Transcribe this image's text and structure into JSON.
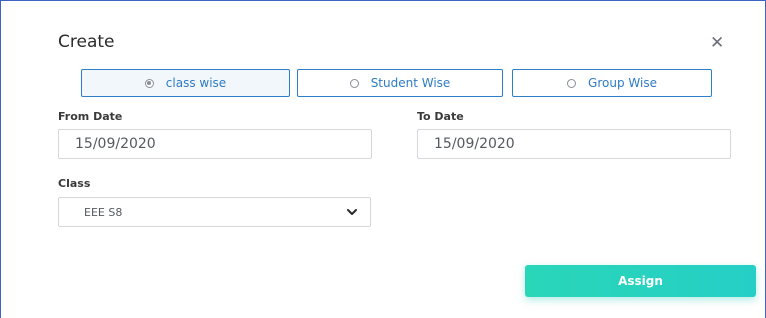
{
  "dialog": {
    "title": "Create",
    "close_icon": "close-icon"
  },
  "mode_options": [
    {
      "label": "class wise",
      "selected": true
    },
    {
      "label": "Student Wise",
      "selected": false
    },
    {
      "label": "Group Wise",
      "selected": false
    }
  ],
  "from_date": {
    "label": "From Date",
    "value": "15/09/2020"
  },
  "to_date": {
    "label": "To Date",
    "value": "15/09/2020"
  },
  "class_field": {
    "label": "Class",
    "selected_value": "EEE S8",
    "icon": "chevron-down-icon"
  },
  "actions": {
    "assign_label": "Assign"
  },
  "colors": {
    "accent_blue": "#2c7fc6",
    "assign_teal": "#2ad6b8"
  }
}
